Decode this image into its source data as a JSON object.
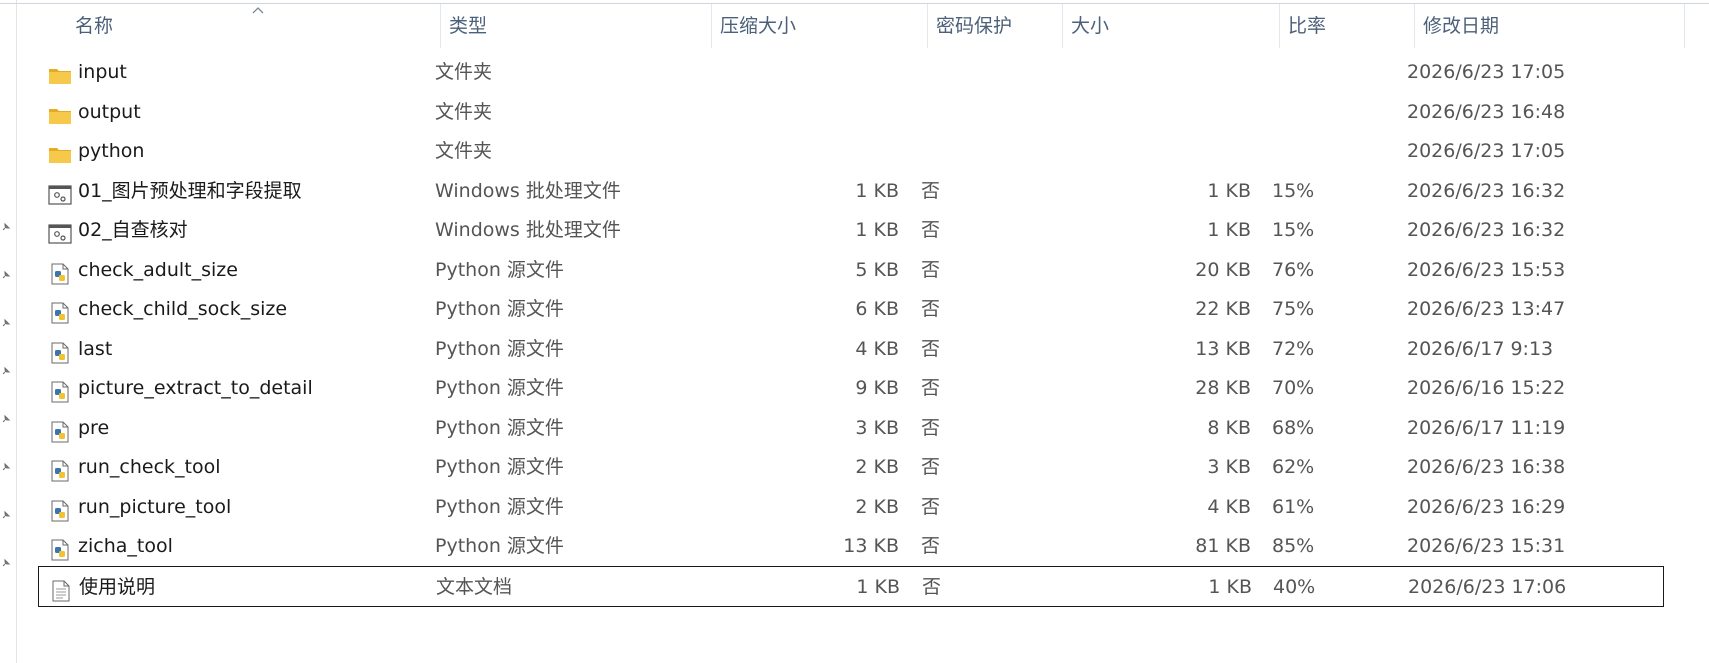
{
  "columns": {
    "name": "名称",
    "type": "类型",
    "compressed": "压缩大小",
    "password": "密码保护",
    "size": "大小",
    "ratio": "比率",
    "modified": "修改日期"
  },
  "files": [
    {
      "icon": "folder-icon",
      "name": "input",
      "type": "文件夹",
      "compressed": "",
      "password": "",
      "size": "",
      "ratio": "",
      "modified": "2026/6/23 17:05"
    },
    {
      "icon": "folder-icon",
      "name": "output",
      "type": "文件夹",
      "compressed": "",
      "password": "",
      "size": "",
      "ratio": "",
      "modified": "2026/6/23 16:48"
    },
    {
      "icon": "folder-icon",
      "name": "python",
      "type": "文件夹",
      "compressed": "",
      "password": "",
      "size": "",
      "ratio": "",
      "modified": "2026/6/23 17:05"
    },
    {
      "icon": "batch-file-icon",
      "name": "01_图片预处理和字段提取",
      "type": "Windows 批处理文件",
      "compressed": "1 KB",
      "password": "否",
      "size": "1 KB",
      "ratio": "15%",
      "modified": "2026/6/23 16:32"
    },
    {
      "icon": "batch-file-icon",
      "name": "02_自查核对",
      "type": "Windows 批处理文件",
      "compressed": "1 KB",
      "password": "否",
      "size": "1 KB",
      "ratio": "15%",
      "modified": "2026/6/23 16:32"
    },
    {
      "icon": "python-file-icon",
      "name": "check_adult_size",
      "type": "Python 源文件",
      "compressed": "5 KB",
      "password": "否",
      "size": "20 KB",
      "ratio": "76%",
      "modified": "2026/6/23 15:53"
    },
    {
      "icon": "python-file-icon",
      "name": "check_child_sock_size",
      "type": "Python 源文件",
      "compressed": "6 KB",
      "password": "否",
      "size": "22 KB",
      "ratio": "75%",
      "modified": "2026/6/23 13:47"
    },
    {
      "icon": "python-file-icon",
      "name": "last",
      "type": "Python 源文件",
      "compressed": "4 KB",
      "password": "否",
      "size": "13 KB",
      "ratio": "72%",
      "modified": "2026/6/17 9:13"
    },
    {
      "icon": "python-file-icon",
      "name": "picture_extract_to_detail",
      "type": "Python 源文件",
      "compressed": "9 KB",
      "password": "否",
      "size": "28 KB",
      "ratio": "70%",
      "modified": "2026/6/16 15:22"
    },
    {
      "icon": "python-file-icon",
      "name": "pre",
      "type": "Python 源文件",
      "compressed": "3 KB",
      "password": "否",
      "size": "8 KB",
      "ratio": "68%",
      "modified": "2026/6/17 11:19"
    },
    {
      "icon": "python-file-icon",
      "name": "run_check_tool",
      "type": "Python 源文件",
      "compressed": "2 KB",
      "password": "否",
      "size": "3 KB",
      "ratio": "62%",
      "modified": "2026/6/23 16:38"
    },
    {
      "icon": "python-file-icon",
      "name": "run_picture_tool",
      "type": "Python 源文件",
      "compressed": "2 KB",
      "password": "否",
      "size": "4 KB",
      "ratio": "61%",
      "modified": "2026/6/23 16:29"
    },
    {
      "icon": "python-file-icon",
      "name": "zicha_tool",
      "type": "Python 源文件",
      "compressed": "13 KB",
      "password": "否",
      "size": "81 KB",
      "ratio": "85%",
      "modified": "2026/6/23 15:31"
    },
    {
      "icon": "text-file-icon",
      "name": "使用说明",
      "type": "文本文档",
      "compressed": "1 KB",
      "password": "否",
      "size": "1 KB",
      "ratio": "40%",
      "modified": "2026/6/23 17:06",
      "selected": true
    }
  ],
  "colors": {
    "folder": "#f6c94a",
    "folder_dark": "#e2ac24",
    "python_blue": "#3b75b0",
    "python_yellow": "#f2c230",
    "header_text": "#4c607a",
    "selection_border": "#1a1a1a"
  }
}
